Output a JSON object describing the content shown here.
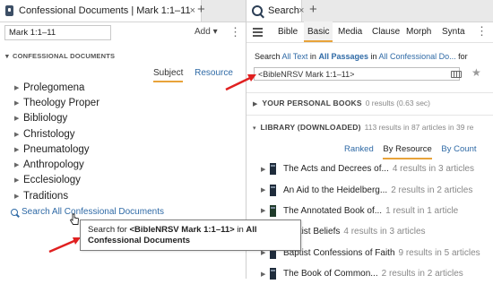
{
  "left": {
    "tab_title": "Confessional Documents | Mark 1:1–11",
    "tab_close": "×",
    "tab_add": "+",
    "reference": "Mark 1:1–11",
    "add_label": "Add ▾",
    "kebab": "⋮",
    "section_title": "CONFESSIONAL DOCUMENTS",
    "section_caret": "▾",
    "subtabs": {
      "subject": "Subject",
      "resource": "Resource"
    },
    "tree": [
      {
        "label": "Prolegomena"
      },
      {
        "label": "Theology Proper"
      },
      {
        "label": "Bibliology"
      },
      {
        "label": "Christology"
      },
      {
        "label": "Pneumatology"
      },
      {
        "label": "Anthropology"
      },
      {
        "label": "Ecclesiology"
      },
      {
        "label": "Traditions"
      }
    ],
    "tree_arrow": "▶",
    "search_all": "Search All Confessional Documents",
    "tooltip": {
      "prefix": "Search for ",
      "query": "<BibleNRSV Mark 1:1–11>",
      "middle": " in ",
      "target": "All Confessional Documents"
    }
  },
  "right": {
    "tab_title": "Search",
    "tab_close": "×",
    "tab_add": "+",
    "modes": [
      "Bible",
      "Basic",
      "Media",
      "Clause",
      "Morph",
      "Synta"
    ],
    "active_mode": "Basic",
    "kebab": "⋮",
    "search_line": {
      "w1": "Search",
      "all_text": "All Text",
      "w2": "in",
      "all_passages": "All Passages",
      "w3": "in",
      "scope": "All Confessional Do...",
      "w4": "for"
    },
    "query": "<BibleNRSV Mark 1:1–11>",
    "star": "★",
    "groups": {
      "personal": {
        "caret": "▶",
        "title": "YOUR PERSONAL BOOKS",
        "meta": "0 results (0.63 sec)"
      },
      "library": {
        "caret": "▾",
        "title": "LIBRARY (DOWNLOADED)",
        "meta": "113 results in 87 articles in 39 re"
      }
    },
    "sort": {
      "ranked": "Ranked",
      "by_resource": "By Resource",
      "by_count": "By Count"
    },
    "result_arrow": "▶",
    "results": [
      {
        "name": "The Acts and Decrees of...",
        "count": "4 results in 3 articles"
      },
      {
        "name": "An Aid to the Heidelberg...",
        "count": "2 results in 2 articles"
      },
      {
        "name": "The Annotated Book of...",
        "count": "1 result in 1 article"
      },
      {
        "name": "Baptist Beliefs",
        "count": "4 results in 3 articles"
      },
      {
        "name": "Baptist Confessions of Faith",
        "count": "9 results in 5 articles"
      },
      {
        "name": "The Book of Common...",
        "count": "2 results in 2 articles"
      }
    ]
  },
  "colors": {
    "accent": "#e8a33a",
    "link": "#2f6aa6",
    "annotation_arrow": "#e02020"
  }
}
